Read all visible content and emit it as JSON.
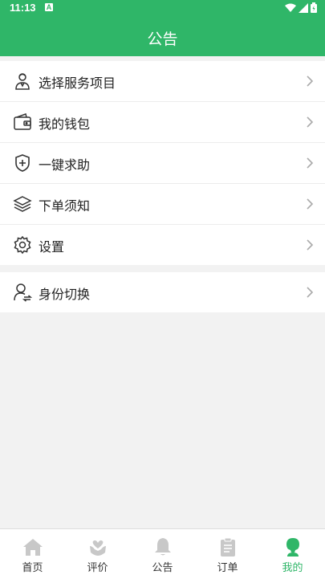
{
  "status": {
    "time": "11:13",
    "notif_letter": "A"
  },
  "header": {
    "title": "公告"
  },
  "menu_main": [
    {
      "label": "选择服务项目",
      "icon": "service-person-icon"
    },
    {
      "label": "我的钱包",
      "icon": "wallet-icon"
    },
    {
      "label": "一键求助",
      "icon": "shield-plus-icon"
    },
    {
      "label": "下单须知",
      "icon": "layers-icon"
    },
    {
      "label": "设置",
      "icon": "gear-icon"
    }
  ],
  "menu_secondary": [
    {
      "label": "身份切换",
      "icon": "user-switch-icon"
    }
  ],
  "tabs": [
    {
      "label": "首页",
      "icon": "home-icon",
      "active": false
    },
    {
      "label": "评价",
      "icon": "heart-hands-icon",
      "active": false
    },
    {
      "label": "公告",
      "icon": "bell-icon",
      "active": false
    },
    {
      "label": "订单",
      "icon": "clipboard-icon",
      "active": false
    },
    {
      "label": "我的",
      "icon": "profile-icon",
      "active": true
    }
  ],
  "colors": {
    "accent": "#2fb668",
    "inactive_icon": "#c8c8c8",
    "background": "#f2f2f2"
  }
}
